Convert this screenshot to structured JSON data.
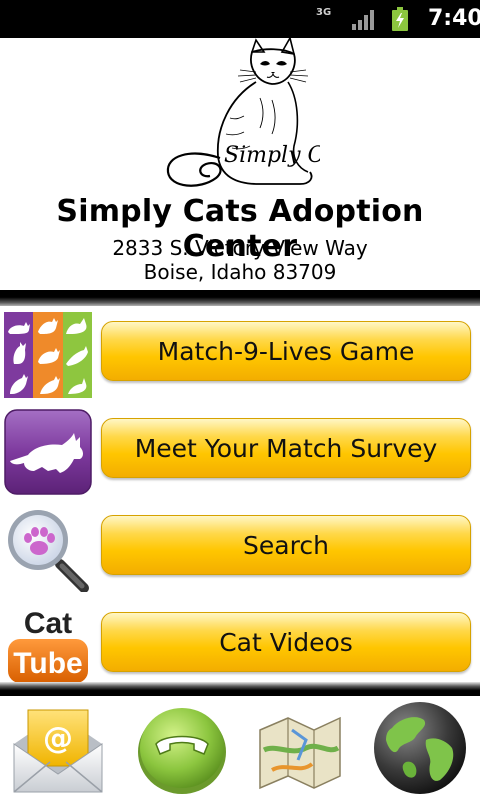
{
  "status_bar": {
    "network": "3G",
    "time": "7:40",
    "signal_icon": "signal-bars-icon",
    "battery_icon": "battery-charging-icon"
  },
  "header": {
    "logo_text": "Simply Cats",
    "title": "Simply Cats Adoption Center",
    "address_line1": "2833 S. Victory View Way",
    "address_line2": "Boise, Idaho 83709"
  },
  "menu": [
    {
      "label": "Match-9-Lives Game",
      "icon": "cat-grid-icon"
    },
    {
      "label": "Meet Your Match Survey",
      "icon": "cat-silhouette-icon"
    },
    {
      "label": "Search",
      "icon": "magnifier-paw-icon"
    },
    {
      "label": "Cat Videos",
      "icon": "cat-tube-icon",
      "icon_text_top": "Cat",
      "icon_text_bottom": "Tube"
    }
  ],
  "bottom_bar": [
    "email-icon",
    "phone-icon",
    "map-icon",
    "globe-icon"
  ],
  "colors": {
    "button_yellow": "#ffc600",
    "purple": "#7e3a9e",
    "orange": "#ef8a2a",
    "green": "#8ec63f"
  }
}
